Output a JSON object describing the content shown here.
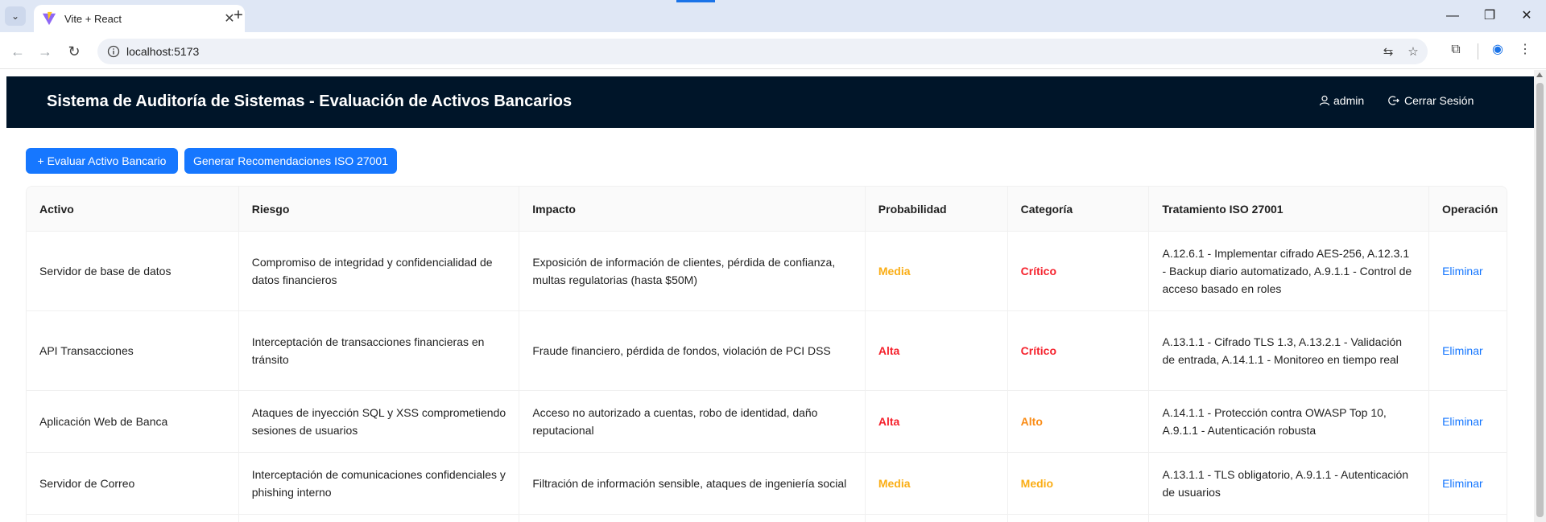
{
  "browser": {
    "tab_title": "Vite + React",
    "url": "localhost:5173"
  },
  "header": {
    "title": "Sistema de Auditoría de Sistemas - Evaluación de Activos Bancarios",
    "user": "admin",
    "logout": "Cerrar Sesión"
  },
  "actions": {
    "evaluate": "+ Evaluar Activo Bancario",
    "recommend": "Generar Recomendaciones ISO 27001"
  },
  "table": {
    "columns": [
      "Activo",
      "Riesgo",
      "Impacto",
      "Probabilidad",
      "Categoría",
      "Tratamiento ISO 27001",
      "Operación"
    ],
    "rows": [
      {
        "activo": "Servidor de base de datos",
        "riesgo": "Compromiso de integridad y confidencialidad de datos financieros",
        "impacto": "Exposición de información de clientes, pérdida de confianza, multas regulatorias (hasta $50M)",
        "probabilidad": "Media",
        "categoria": "Crítico",
        "tratamiento": "A.12.6.1 - Implementar cifrado AES-256, A.12.3.1 - Backup diario automatizado, A.9.1.1 - Control de acceso basado en roles",
        "operacion": "Eliminar"
      },
      {
        "activo": "API Transacciones",
        "riesgo": "Interceptación de transacciones financieras en tránsito",
        "impacto": "Fraude financiero, pérdida de fondos, violación de PCI DSS",
        "probabilidad": "Alta",
        "categoria": "Crítico",
        "tratamiento": "A.13.1.1 - Cifrado TLS 1.3, A.13.2.1 - Validación de entrada, A.14.1.1 - Monitoreo en tiempo real",
        "operacion": "Eliminar"
      },
      {
        "activo": "Aplicación Web de Banca",
        "riesgo": "Ataques de inyección SQL y XSS comprometiendo sesiones de usuarios",
        "impacto": "Acceso no autorizado a cuentas, robo de identidad, daño reputacional",
        "probabilidad": "Alta",
        "categoria": "Alto",
        "tratamiento": "A.14.1.1 - Protección contra OWASP Top 10, A.9.1.1 - Autenticación robusta",
        "operacion": "Eliminar"
      },
      {
        "activo": "Servidor de Correo",
        "riesgo": "Interceptación de comunicaciones confidenciales y phishing interno",
        "impacto": "Filtración de información sensible, ataques de ingeniería social",
        "probabilidad": "Media",
        "categoria": "Medio",
        "tratamiento": "A.13.1.1 - TLS obligatorio, A.9.1.1 - Autenticación de usuarios",
        "operacion": "Eliminar"
      }
    ]
  },
  "colors": {
    "header_bg": "#001529",
    "primary": "#1677ff",
    "critical": "#f5222d",
    "high": "#fa8c16",
    "medium": "#faad14"
  }
}
